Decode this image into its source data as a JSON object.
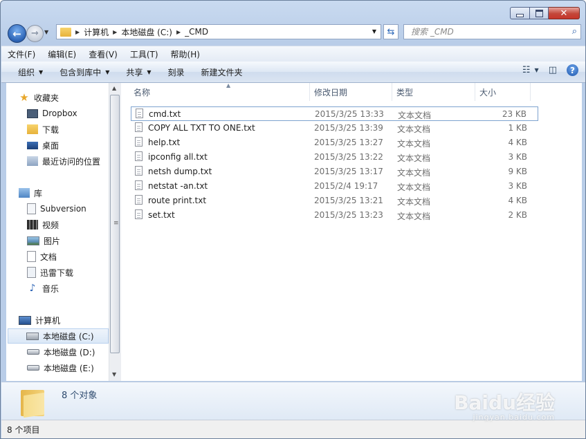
{
  "window": {
    "min": "—",
    "max": "□",
    "close": "✕"
  },
  "nav": {
    "address_crumbs": [
      "计算机",
      "本地磁盘 (C:)",
      "_CMD"
    ],
    "search_placeholder": "搜索 _CMD"
  },
  "menu": [
    "文件(F)",
    "编辑(E)",
    "查看(V)",
    "工具(T)",
    "帮助(H)"
  ],
  "toolbar": {
    "organize": "组织",
    "include_library": "包含到库中",
    "share": "共享",
    "burn": "刻录",
    "new_folder": "新建文件夹"
  },
  "sidebar": {
    "favorites": {
      "title": "收藏夹",
      "items": [
        "Dropbox",
        "下载",
        "桌面",
        "最近访问的位置"
      ]
    },
    "libraries": {
      "title": "库",
      "items": [
        "Subversion",
        "视频",
        "图片",
        "文档",
        "迅雷下载",
        "音乐"
      ]
    },
    "computer": {
      "title": "计算机",
      "items": [
        "本地磁盘 (C:)",
        "本地磁盘 (D:)",
        "本地磁盘 (E:)"
      ]
    }
  },
  "columns": {
    "name": "名称",
    "date": "修改日期",
    "type": "类型",
    "size": "大小"
  },
  "files": [
    {
      "name": "cmd.txt",
      "date": "2015/3/25 13:33",
      "type": "文本文档",
      "size": "23 KB"
    },
    {
      "name": "COPY ALL TXT TO ONE.txt",
      "date": "2015/3/25 13:39",
      "type": "文本文档",
      "size": "1 KB"
    },
    {
      "name": "help.txt",
      "date": "2015/3/25 13:27",
      "type": "文本文档",
      "size": "4 KB"
    },
    {
      "name": "ipconfig all.txt",
      "date": "2015/3/25 13:22",
      "type": "文本文档",
      "size": "3 KB"
    },
    {
      "name": "netsh dump.txt",
      "date": "2015/3/25 13:17",
      "type": "文本文档",
      "size": "9 KB"
    },
    {
      "name": "netstat -an.txt",
      "date": "2015/2/4 19:17",
      "type": "文本文档",
      "size": "3 KB"
    },
    {
      "name": "route print.txt",
      "date": "2015/3/25 13:21",
      "type": "文本文档",
      "size": "4 KB"
    },
    {
      "name": "set.txt",
      "date": "2015/3/25 13:23",
      "type": "文本文档",
      "size": "2 KB"
    }
  ],
  "details": {
    "count": "8 个对象"
  },
  "status": {
    "items": "8 个项目"
  },
  "watermark": {
    "brand": "Baidu经验",
    "url": "jingyan.baidu.com"
  }
}
